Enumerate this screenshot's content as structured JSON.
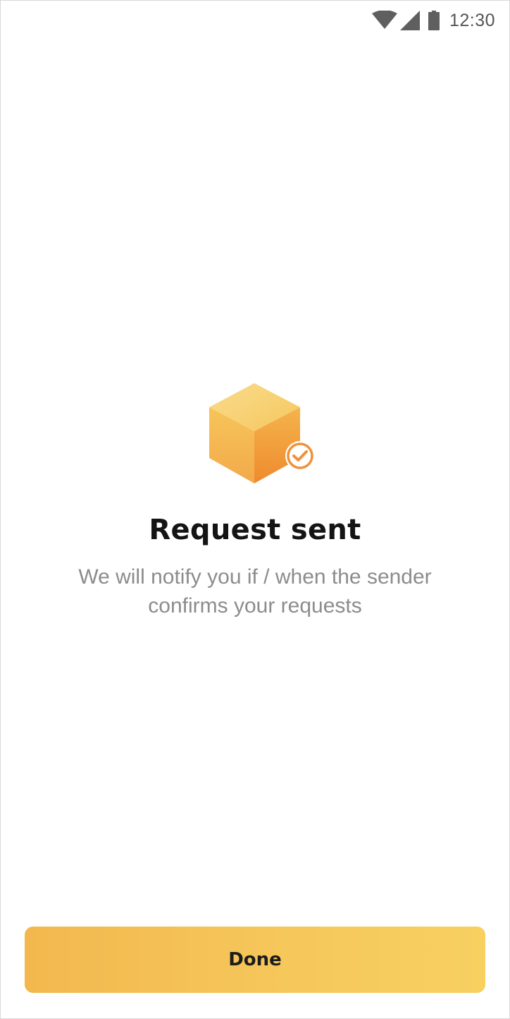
{
  "status_bar": {
    "time": "12:30",
    "icons": [
      "wifi-icon",
      "cellular-signal-icon",
      "battery-icon"
    ]
  },
  "confirmation": {
    "illustration": "package-check-icon",
    "title": "Request sent",
    "message": "We will notify you if / when the sender confirms your requests"
  },
  "actions": {
    "done_label": "Done"
  },
  "colors": {
    "accent_start": "#f2b84e",
    "accent_end": "#f7d060",
    "cube_dark": "#f08a2c",
    "title": "#141414",
    "subtitle": "#8c8c8c"
  }
}
